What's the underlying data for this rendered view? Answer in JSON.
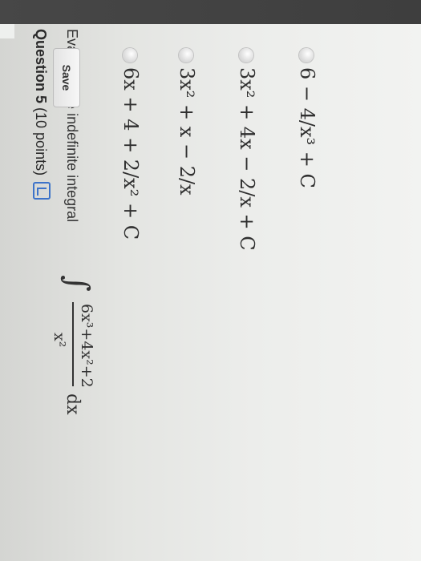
{
  "question": {
    "number_label": "Question 5",
    "points_label": "(10 points)"
  },
  "instruction": "Evaluate the indefinite integral",
  "integral": {
    "sign": "∫",
    "numerator": "6x³+4x²+2",
    "denominator": "x²",
    "differential": "dx"
  },
  "options": [
    {
      "text": "6x + 4 + 2/x² + C"
    },
    {
      "text": "3x² + x − 2/x"
    },
    {
      "text": "3x² + 4x − 2/x + C"
    },
    {
      "text": "6 − 4/x³ + C"
    }
  ],
  "actions": {
    "save_label": "Save"
  },
  "icons": {
    "question_icon": "book-icon"
  },
  "colors": {
    "top_bar": "#444444",
    "icon_accent": "#3d73c9"
  }
}
